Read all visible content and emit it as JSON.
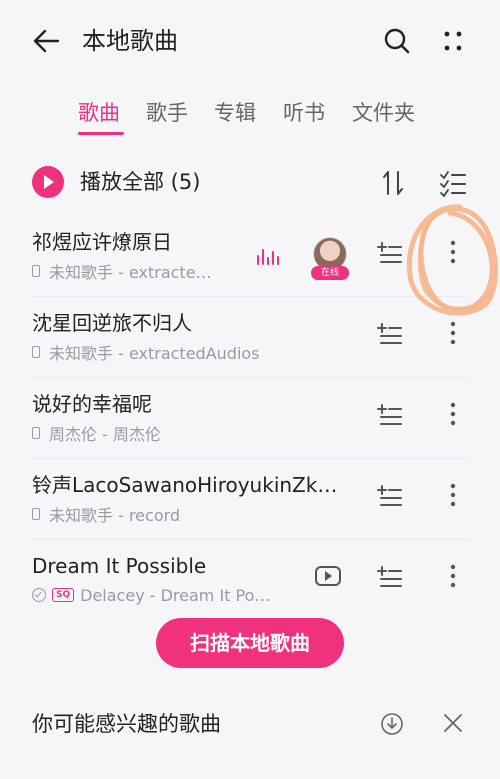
{
  "header": {
    "title": "本地歌曲"
  },
  "tabs": [
    {
      "label": "歌曲",
      "active": true
    },
    {
      "label": "歌手",
      "active": false
    },
    {
      "label": "专辑",
      "active": false
    },
    {
      "label": "听书",
      "active": false
    },
    {
      "label": "文件夹",
      "active": false
    }
  ],
  "play_all": {
    "label": "播放全部 (5)"
  },
  "songs": [
    {
      "title": "祁煜应许燎原日",
      "subtitle": "未知歌手 - extracte…",
      "online_badge": "在线"
    },
    {
      "title": "沈星回逆旅不归人",
      "subtitle": "未知歌手 - extractedAudios"
    },
    {
      "title": "说好的幸福呢",
      "subtitle": "周杰伦 - 周杰伦"
    },
    {
      "title": "铃声LacoSawanoHiroyukinZk…",
      "subtitle": "未知歌手 - record"
    },
    {
      "title": "Dream It Possible",
      "sq_badge": "SQ",
      "subtitle": "Delacey - Dream It Po…"
    }
  ],
  "scan_button": {
    "label": "扫描本地歌曲"
  },
  "recommend": {
    "title": "你可能感兴趣的歌曲"
  },
  "colors": {
    "accent": "#f0317e",
    "background": "#f6f6f8",
    "annotation": "#f6b58a"
  },
  "icons": [
    "back-arrow-icon",
    "search-icon",
    "more-dots-icon",
    "play-circle-icon",
    "sort-icon",
    "multi-select-icon",
    "equalizer-icon",
    "video-icon",
    "add-to-queue-icon",
    "download-circle-icon",
    "close-icon"
  ]
}
